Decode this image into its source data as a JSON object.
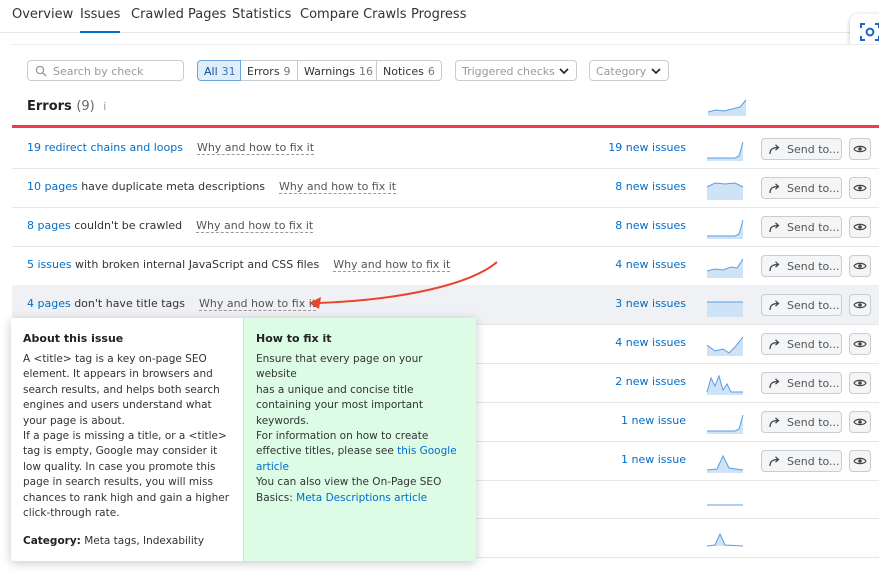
{
  "tabs": [
    "Overview",
    "Issues",
    "Crawled Pages",
    "Statistics",
    "Compare Crawls",
    "Progress"
  ],
  "active_tab": "Issues",
  "filters": {
    "search_placeholder": "Search by check",
    "segments": [
      {
        "label": "All",
        "count": "31",
        "active": true
      },
      {
        "label": "Errors",
        "count": "9"
      },
      {
        "label": "Warnings",
        "count": "16"
      },
      {
        "label": "Notices",
        "count": "6"
      }
    ],
    "triggered_checks": "Triggered checks",
    "category": "Category"
  },
  "errors_section": {
    "title": "Errors",
    "count": "(9)",
    "info_icon": "i"
  },
  "rows": [
    {
      "link": "19 redirect chains and loops",
      "text": "",
      "why": "Why and how to fix it",
      "new": "19 new issues",
      "spark": "rise-end"
    },
    {
      "link": "10 pages",
      "text": " have duplicate meta descriptions",
      "why": "Why and how to fix it",
      "new": "8 new issues",
      "spark": "plateau"
    },
    {
      "link": "8 pages",
      "text": " couldn't be crawled",
      "why": "Why and how to fix it",
      "new": "8 new issues",
      "spark": "rise-end"
    },
    {
      "link": "5 issues",
      "text": " with broken internal JavaScript and CSS files",
      "why": "Why and how to fix it",
      "new": "4 new issues",
      "spark": "wave-rise"
    },
    {
      "link": "4 pages",
      "text": " don't have title tags",
      "why": "Why and how to fix it",
      "new": "3 new issues",
      "spark": "flat-high"
    },
    {
      "link": "",
      "text": "",
      "why": "",
      "new": "4 new issues",
      "spark": "dip-rise"
    },
    {
      "link": "",
      "text": "",
      "why": "",
      "new": "2 new issues",
      "spark": "peaks"
    },
    {
      "link": "",
      "text": "",
      "why": "",
      "new": "1 new issue",
      "spark": "rise-end"
    },
    {
      "link": "",
      "text": "",
      "why": "",
      "new": "1 new issue",
      "spark": "peak"
    }
  ],
  "send_label": "Send to...",
  "popup": {
    "about_title": "About this issue",
    "about_lines": [
      "A <title> tag is a key on-page SEO",
      "element. It appears in browsers and",
      "search results, and helps both search",
      "engines and users understand what",
      "your page is about.",
      "If a page is missing a title, or a <title>",
      "tag is empty, Google may consider it",
      "low quality. In case you promote this",
      "page in search results, you will miss",
      "chances to rank high and gain a higher",
      "click-through rate."
    ],
    "category_label": "Category:",
    "category_value": " Meta tags, Indexability",
    "fix_title": "How to fix it",
    "fix_lines": [
      "Ensure that every page on your website",
      "has a unique and concise title",
      "containing your most important",
      "keywords.",
      "For information on how to create",
      "effective titles, please see "
    ],
    "fix_link1a": "this Google",
    "fix_link1b": "article",
    "fix_line2a": "You can also view the On-Page SEO",
    "fix_line2b": "Basics: ",
    "fix_link2": "Meta Descriptions article"
  },
  "colors": {
    "accent": "#006dca",
    "error_line": "#ee3a4b",
    "fix_bg": "#dcfce6",
    "arrow": "#e8442e"
  }
}
